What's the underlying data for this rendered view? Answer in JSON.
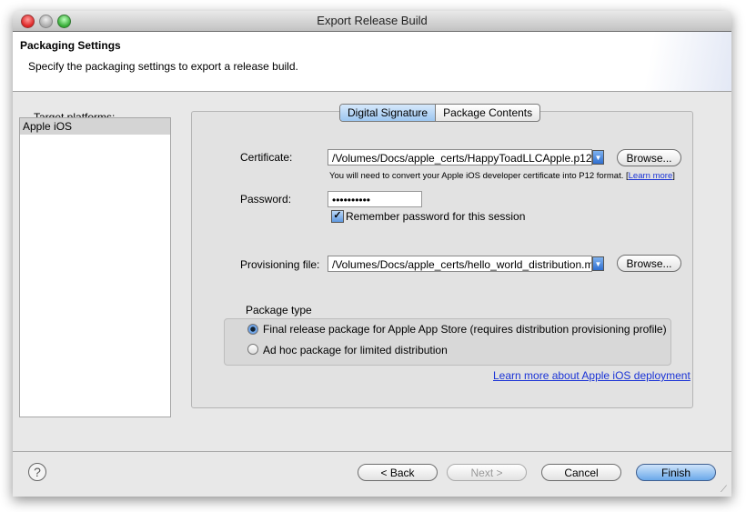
{
  "window": {
    "title": "Export Release Build"
  },
  "header": {
    "title": "Packaging Settings",
    "description": "Specify the packaging settings to export a release build."
  },
  "platforms": {
    "label": "Target platforms:",
    "items": [
      "Apple iOS"
    ]
  },
  "tabs": [
    {
      "label": "Digital Signature",
      "active": true
    },
    {
      "label": "Package Contents",
      "active": false
    }
  ],
  "certificate": {
    "label": "Certificate:",
    "value": "/Volumes/Docs/apple_certs/HappyToadLLCApple.p12",
    "browse": "Browse...",
    "hint": "You will need to convert your Apple iOS developer certificate into P12 format. [",
    "hint_link": "Learn more",
    "hint_end": "]"
  },
  "password": {
    "label": "Password:",
    "value": "••••••••••",
    "remember_label": "Remember password for this session",
    "remember_checked": true
  },
  "provisioning": {
    "label": "Provisioning file:",
    "value": "/Volumes/Docs/apple_certs/hello_world_distribution.mobileprovision",
    "browse": "Browse..."
  },
  "package_type": {
    "label": "Package type",
    "options": [
      {
        "label": "Final release package for Apple App Store (requires distribution provisioning profile)",
        "selected": true
      },
      {
        "label": "Ad hoc package for limited distribution",
        "selected": false
      }
    ]
  },
  "deploy_link": "Learn more about Apple iOS deployment",
  "footer": {
    "back": "< Back",
    "next": "Next >",
    "cancel": "Cancel",
    "finish": "Finish"
  }
}
